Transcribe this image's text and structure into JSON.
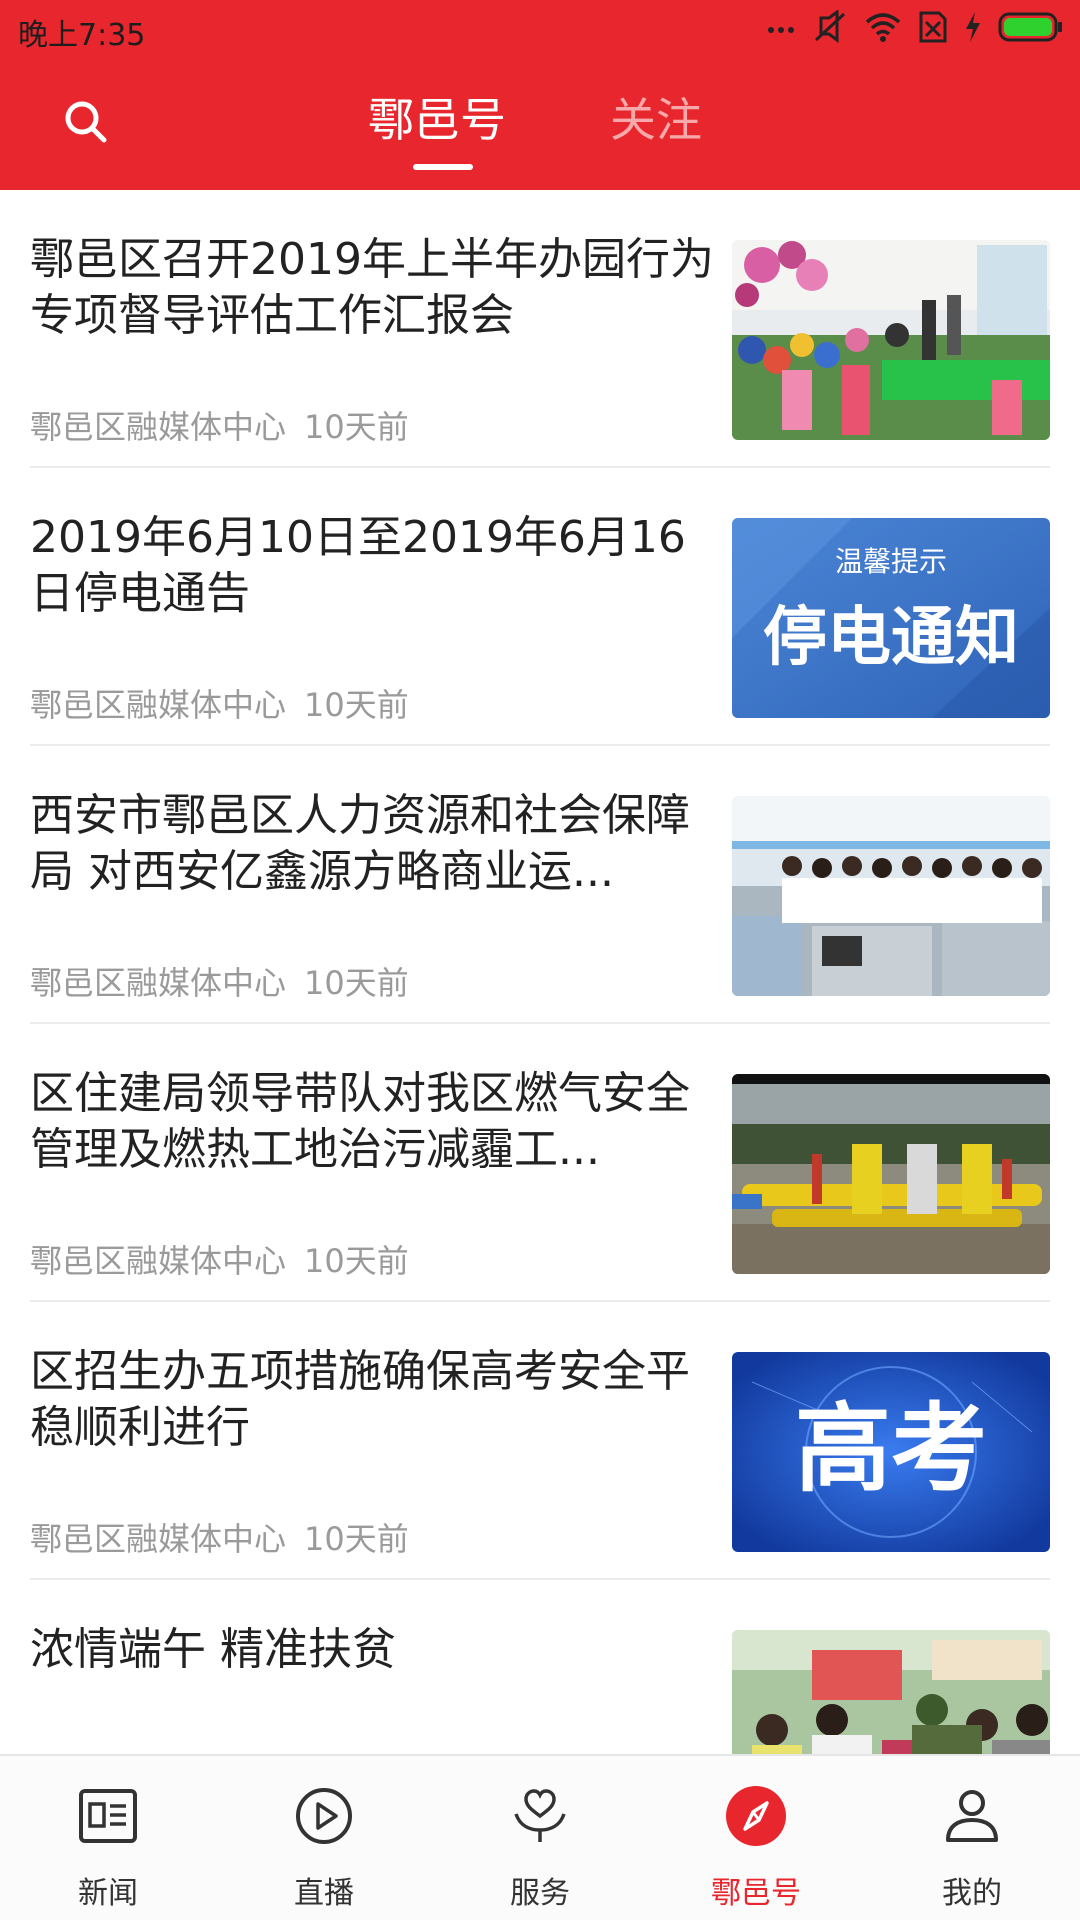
{
  "status_bar": {
    "time": "晚上7:35",
    "icons": [
      "more-dots-icon",
      "mute-icon",
      "wifi-icon",
      "sim-off-icon",
      "charging-icon",
      "battery-icon"
    ],
    "battery_color": "#2fd12f"
  },
  "header": {
    "background": "#e8262d",
    "search_icon": "search-icon",
    "tabs": [
      {
        "label": "鄠邑号",
        "active": true
      },
      {
        "label": "关注",
        "active": false
      }
    ]
  },
  "feed": {
    "items": [
      {
        "title": "鄠邑区召开2019年上半年办园行为专项督导评估工作汇报会",
        "source": "鄠邑区融媒体中心",
        "time": "10天前",
        "thumbnail": "kindergarten-classroom-photo"
      },
      {
        "title": "2019年6月10日至2019年6月16日停电通告",
        "source": "鄠邑区融媒体中心",
        "time": "10天前",
        "thumbnail": "power-outage-notice-banner",
        "thumbnail_text": {
          "top": "温馨提示",
          "main": "停电通知"
        }
      },
      {
        "title": "西安市鄠邑区人力资源和社会保障局 对西安亿鑫源方略商业运...",
        "source": "鄠邑区融媒体中心",
        "time": "10天前",
        "thumbnail": "office-staff-photo"
      },
      {
        "title": "区住建局领导带队对我区燃气安全管理及燃热工地治污减霾工...",
        "source": "鄠邑区融媒体中心",
        "time": "10天前",
        "thumbnail": "gas-pipeline-station-photo"
      },
      {
        "title": "区招生办五项措施确保高考安全平稳顺利进行",
        "source": "鄠邑区融媒体中心",
        "time": "10天前",
        "thumbnail": "gaokao-banner",
        "thumbnail_text": {
          "main": "高考"
        }
      },
      {
        "title": "浓情端午 精准扶贫",
        "source": "",
        "time": "",
        "thumbnail": "dragon-boat-festival-event-photo"
      }
    ]
  },
  "bottom_nav": {
    "active_color": "#e8262d",
    "items": [
      {
        "label": "新闻",
        "icon": "newspaper-icon",
        "active": false
      },
      {
        "label": "直播",
        "icon": "play-circle-icon",
        "active": false
      },
      {
        "label": "服务",
        "icon": "heart-hands-icon",
        "active": false
      },
      {
        "label": "鄠邑号",
        "icon": "compass-icon",
        "active": true
      },
      {
        "label": "我的",
        "icon": "user-icon",
        "active": false
      }
    ]
  }
}
